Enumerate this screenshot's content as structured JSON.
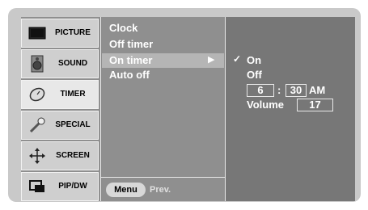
{
  "sidebar": {
    "items": [
      {
        "label": "PICTURE",
        "icon": "tv-screen-icon"
      },
      {
        "label": "SOUND",
        "icon": "speaker-icon"
      },
      {
        "label": "TIMER",
        "icon": "clock-icon",
        "active": true
      },
      {
        "label": "SPECIAL",
        "icon": "wrench-icon"
      },
      {
        "label": "SCREEN",
        "icon": "move-arrows-icon"
      },
      {
        "label": "PIP/DW",
        "icon": "pip-icon"
      }
    ]
  },
  "submenu": {
    "items": [
      "Clock",
      "Off timer",
      "On timer",
      "Auto off"
    ],
    "selected": "On timer",
    "footer": {
      "menu_label": "Menu",
      "prev_label": "Prev."
    }
  },
  "detail": {
    "on_label": "On",
    "off_label": "Off",
    "selected_mark": "✓",
    "hour": "6",
    "separator": ":",
    "minute": "30",
    "ampm": "AM",
    "volume_label": "Volume",
    "volume_value": "17"
  },
  "colors": {
    "panel": "#8f8f8f",
    "detail_panel": "#777777",
    "sidebar_bg": "#cfcfcf",
    "highlight": "#b5b5b5",
    "text": "#ffffff"
  }
}
